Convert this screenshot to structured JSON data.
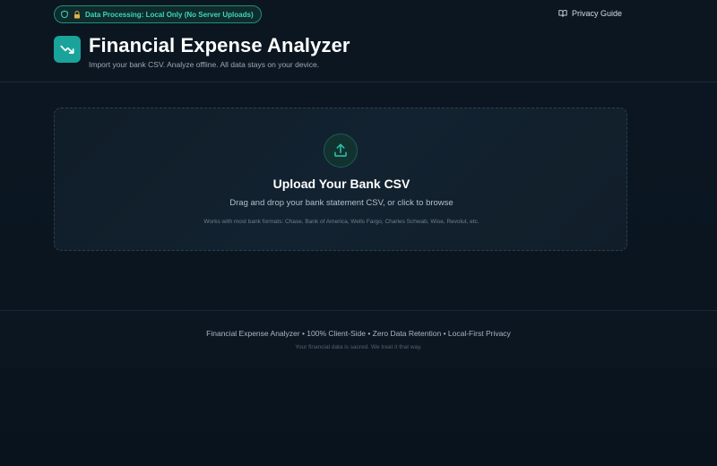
{
  "header": {
    "privacy_badge": "Data Processing: Local Only (No Server Uploads)",
    "privacy_guide": "Privacy Guide",
    "title": "Financial Expense Analyzer",
    "subtitle": "Import your bank CSV. Analyze offline. All data stays on your device."
  },
  "upload": {
    "title": "Upload Your Bank CSV",
    "description": "Drag and drop your bank statement CSV, or click to browse",
    "formats": "Works with most bank formats: Chase, Bank of America, Wells Fargo, Charles Schwab, Wise, Revolut, etc."
  },
  "footer": {
    "main": "Financial Expense Analyzer • 100% Client-Side • Zero Data Retention • Local-First Privacy",
    "sub": "Your financial data is sacred. We treat it that way."
  },
  "icons": {
    "badge_shield": "shield-icon",
    "badge_lock": "lock-icon",
    "guide": "book-open-icon",
    "logo": "trending-down-icon",
    "upload": "upload-icon"
  },
  "colors": {
    "background": "#0b1622",
    "accent": "#1aa39a",
    "badge_text": "#3ed6bd"
  }
}
